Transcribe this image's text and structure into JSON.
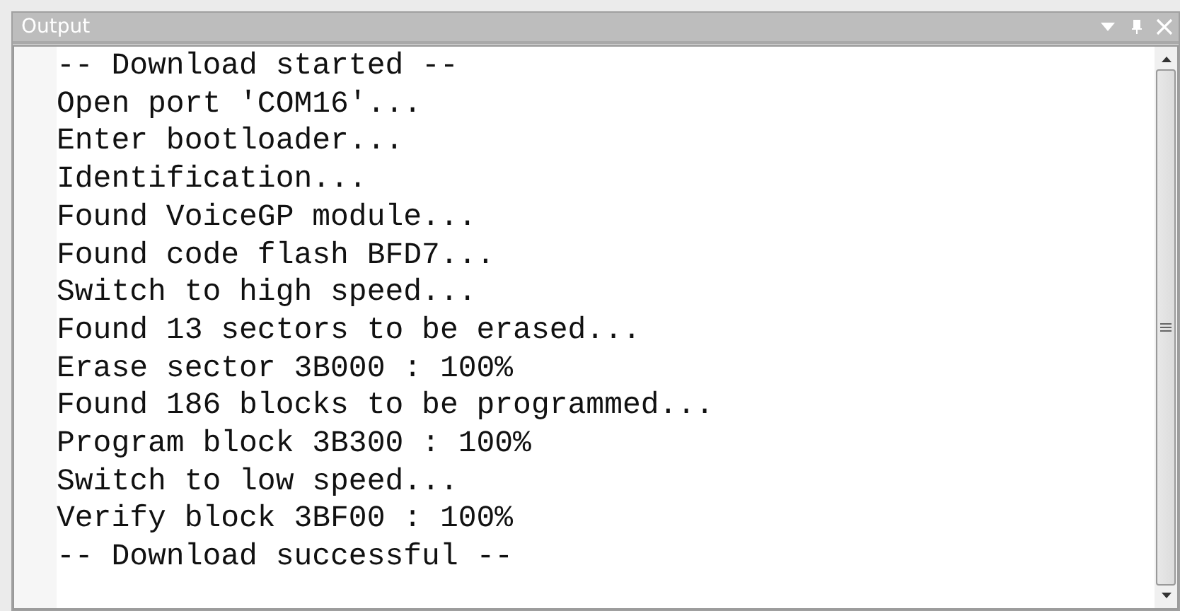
{
  "panel": {
    "title": "Output"
  },
  "lines": [
    "-- Download started --",
    "Open port 'COM16'...",
    "Enter bootloader...",
    "Identification...",
    "Found VoiceGP module...",
    "Found code flash BFD7...",
    "Switch to high speed...",
    "Found 13 sectors to be erased...",
    "Erase sector 3B000 : 100%",
    "Found 186 blocks to be programmed...",
    "Program block 3B300 : 100%",
    "Switch to low speed...",
    "Verify block 3BF00 : 100%",
    "-- Download successful --"
  ]
}
